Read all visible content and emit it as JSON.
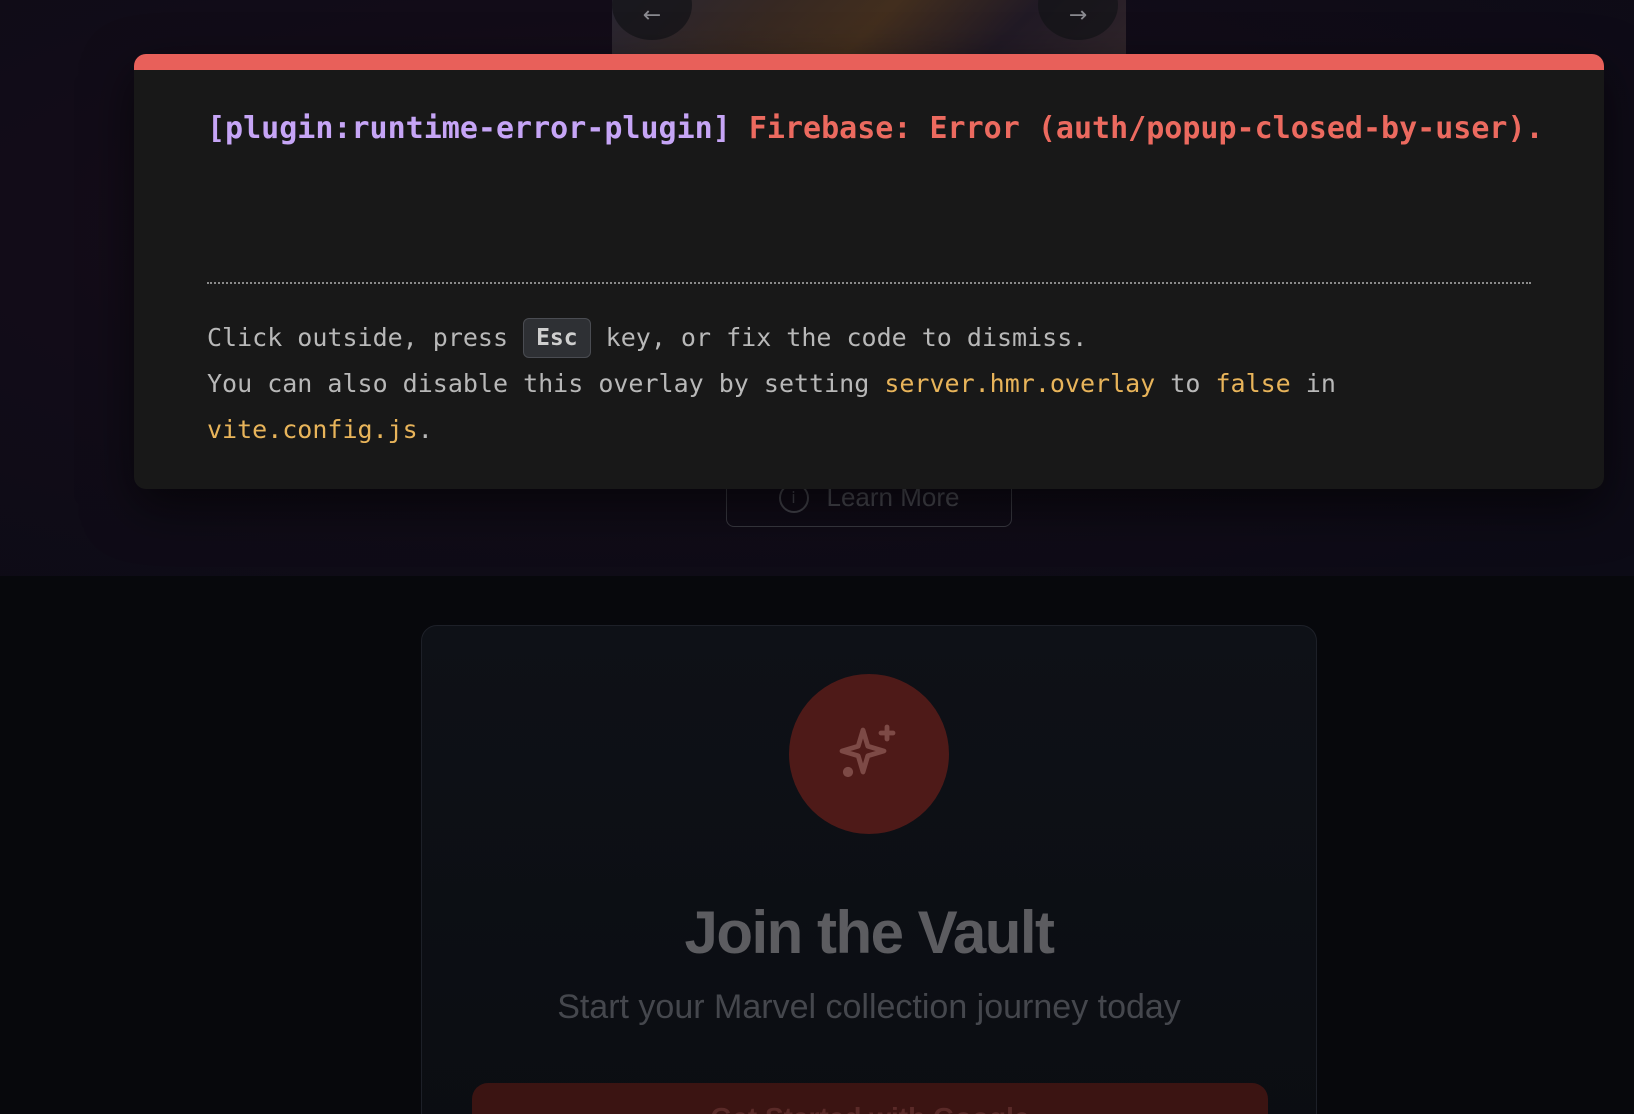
{
  "background": {
    "carousel": {
      "prev_icon": "←",
      "next_icon": "→"
    },
    "learn_more": {
      "label": "Learn More",
      "icon": "info-circle-icon"
    },
    "join_card": {
      "icon": "sparkles-icon",
      "title": "Join the Vault",
      "subtitle": "Start your Marvel collection journey today",
      "cta_label": "Get Started with Google"
    }
  },
  "overlay": {
    "plugin": "[plugin:runtime-error-plugin]",
    "message": "Firebase: Error (auth/popup-closed-by-user).",
    "tip_line1_before": "Click outside, press ",
    "esc_key": "Esc",
    "tip_line1_after": " key, or fix the code to dismiss.",
    "tip_line2_before": "You can also disable this overlay by setting ",
    "setting_name": "server.hmr.overlay",
    "tip_line2_middle": " to ",
    "setting_value": "false",
    "tip_line2_after": " in",
    "config_file": "vite.config.js",
    "tip_end": "."
  },
  "colors": {
    "overlay_accent": "#e8605a",
    "plugin_label": "#c6a5f6",
    "error_text": "#ec6a5f",
    "code_highlight": "#e8b45a"
  }
}
